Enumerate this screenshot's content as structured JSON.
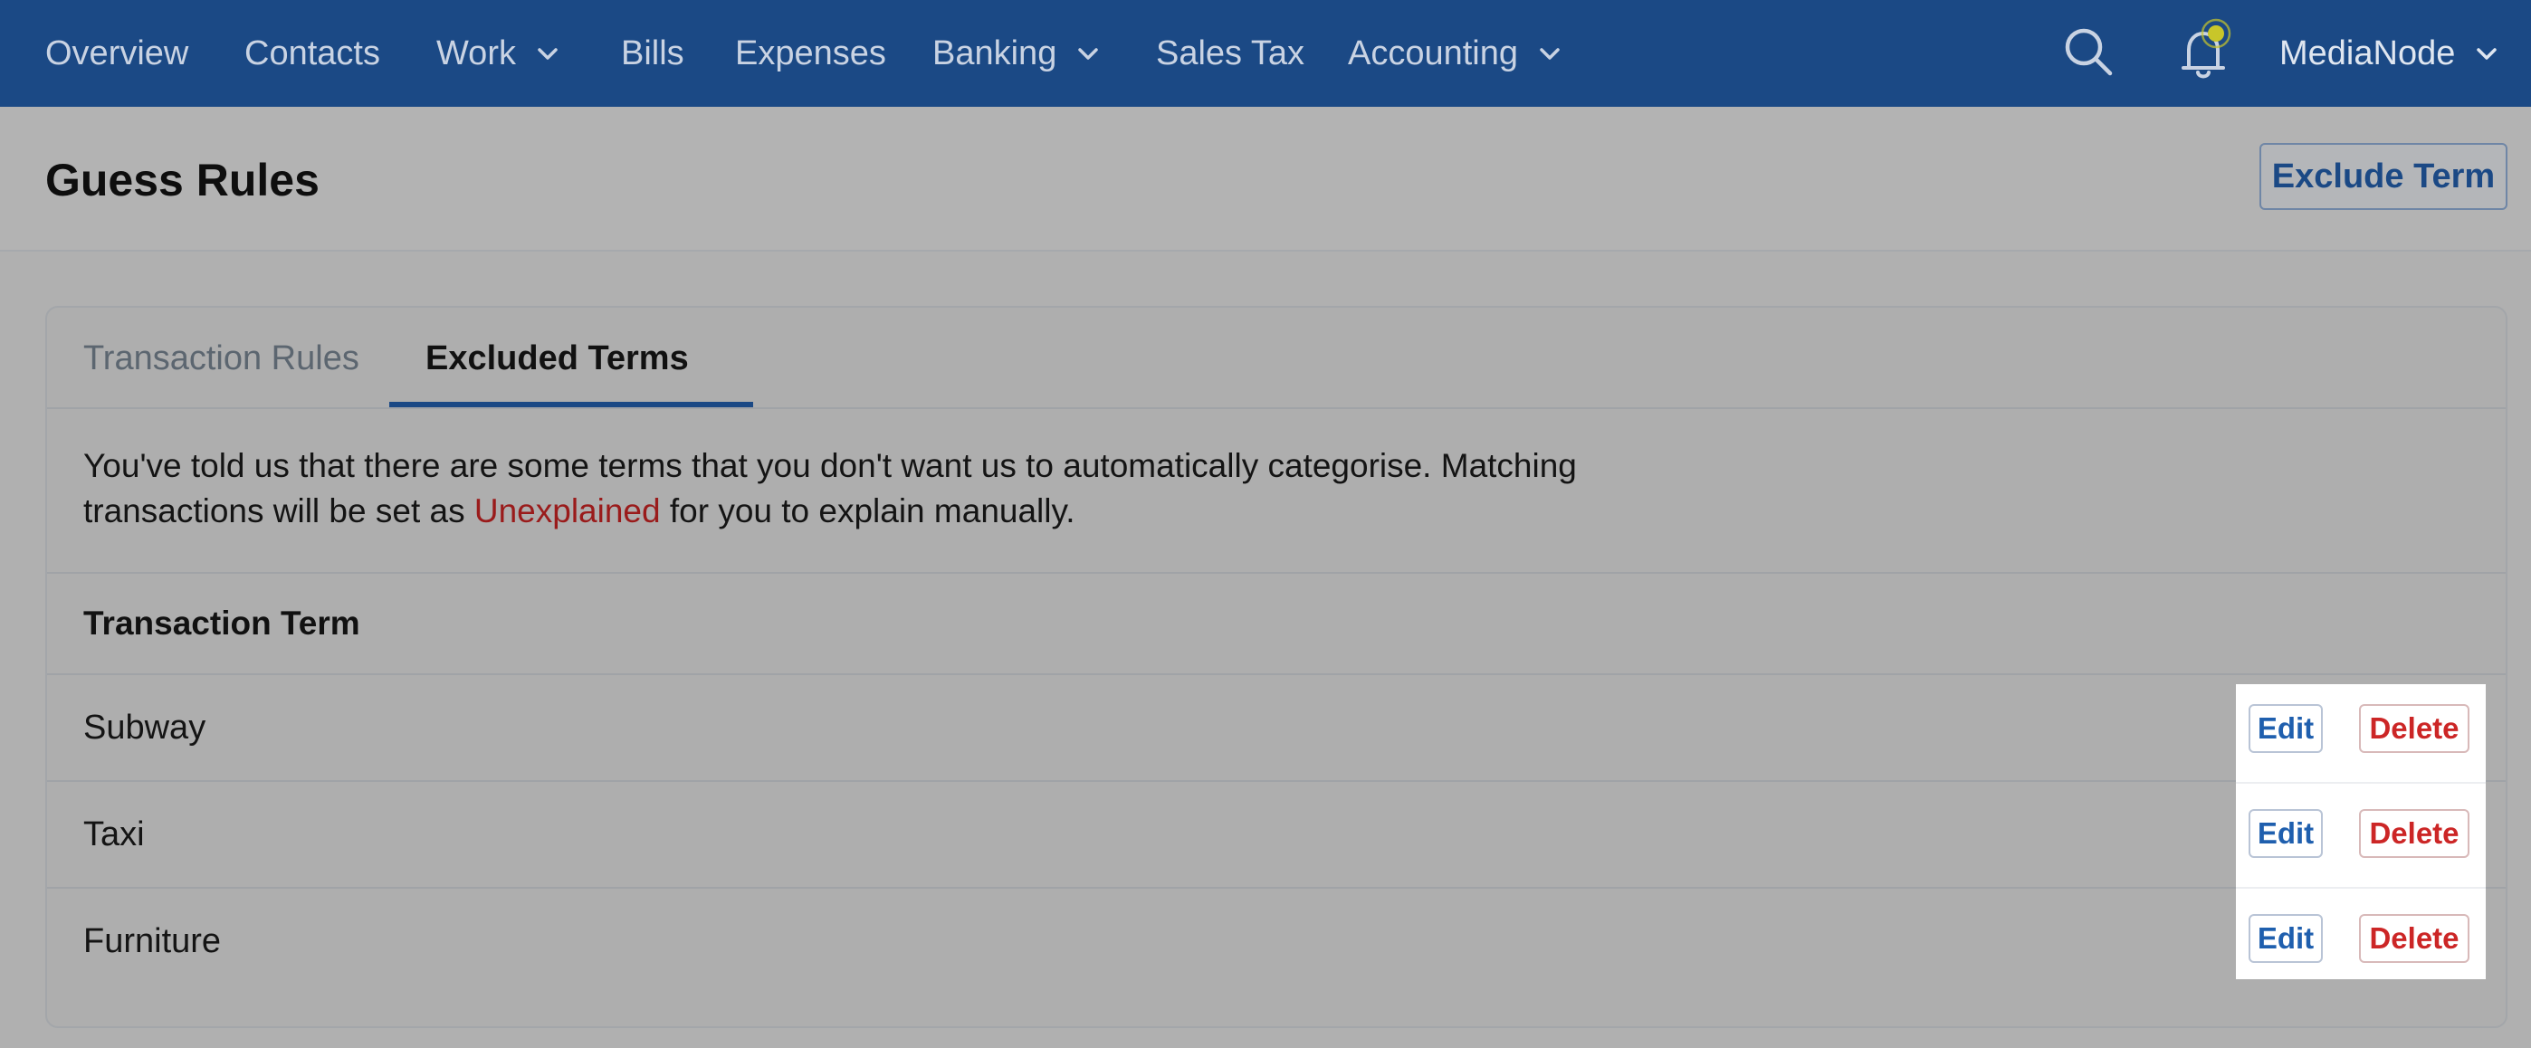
{
  "nav": {
    "items": [
      {
        "label": "Overview",
        "dropdown": false
      },
      {
        "label": "Contacts",
        "dropdown": false
      },
      {
        "label": "Work",
        "dropdown": true
      },
      {
        "label": "Bills",
        "dropdown": false
      },
      {
        "label": "Expenses",
        "dropdown": false
      },
      {
        "label": "Banking",
        "dropdown": true
      },
      {
        "label": "Sales Tax",
        "dropdown": false
      },
      {
        "label": "Accounting",
        "dropdown": true
      }
    ],
    "search_icon": "search-icon",
    "notification_icon": "bell-icon",
    "account_label": "MediaNode"
  },
  "header": {
    "title": "Guess Rules",
    "exclude_button": "Exclude Term"
  },
  "tabs": [
    {
      "label": "Transaction Rules",
      "active": false
    },
    {
      "label": "Excluded Terms",
      "active": true
    }
  ],
  "description": {
    "before": "You've told us that there are some terms that you don't want us to automatically categorise. Matching transactions will be set as ",
    "highlight": "Unexplained",
    "after": " for you to explain manually."
  },
  "table": {
    "header": "Transaction Term",
    "rows": [
      {
        "term": "Subway",
        "edit": "Edit",
        "delete": "Delete"
      },
      {
        "term": "Taxi",
        "edit": "Edit",
        "delete": "Delete"
      },
      {
        "term": "Furniture",
        "edit": "Edit",
        "delete": "Delete"
      }
    ]
  },
  "colors": {
    "nav_bg": "#1b4985",
    "accent": "#1f5fae",
    "danger": "#cc2626",
    "unexplained": "#9a1b1b",
    "notification_dot": "#c8c62a"
  }
}
